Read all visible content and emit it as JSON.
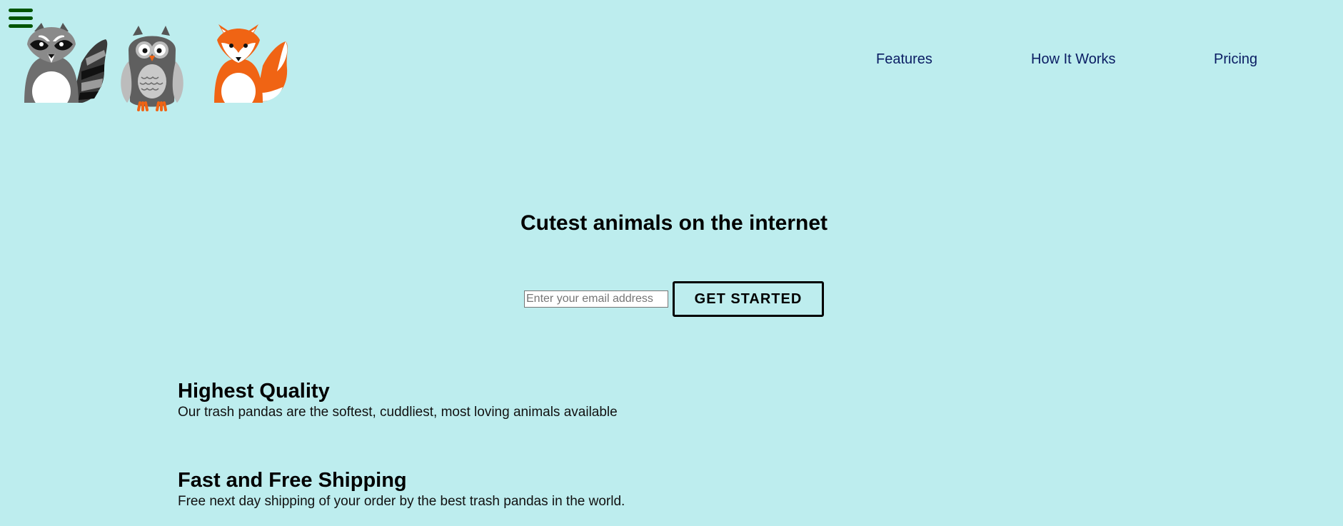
{
  "nav": {
    "menu_icon": "hamburger-icon",
    "items": [
      {
        "label": "Features"
      },
      {
        "label": "How It Works"
      },
      {
        "label": "Pricing"
      }
    ]
  },
  "logo": {
    "icons": [
      "raccoon-icon",
      "owl-icon",
      "fox-icon"
    ]
  },
  "hero": {
    "title": "Cutest animals on the internet",
    "email_placeholder": "Enter your email address",
    "cta_label": "GET STARTED"
  },
  "features": [
    {
      "title": "Highest Quality",
      "text": "Our trash pandas are the softest, cuddliest, most loving animals available"
    },
    {
      "title": "Fast and Free Shipping",
      "text": "Free next day shipping of your order by the best trash pandas in the world."
    }
  ],
  "colors": {
    "background": "#bdedee",
    "nav_link": "#0a1d63",
    "menu_icon": "#005500",
    "fox_orange": "#f06414",
    "raccoon_gray": "#6e6e6e"
  }
}
